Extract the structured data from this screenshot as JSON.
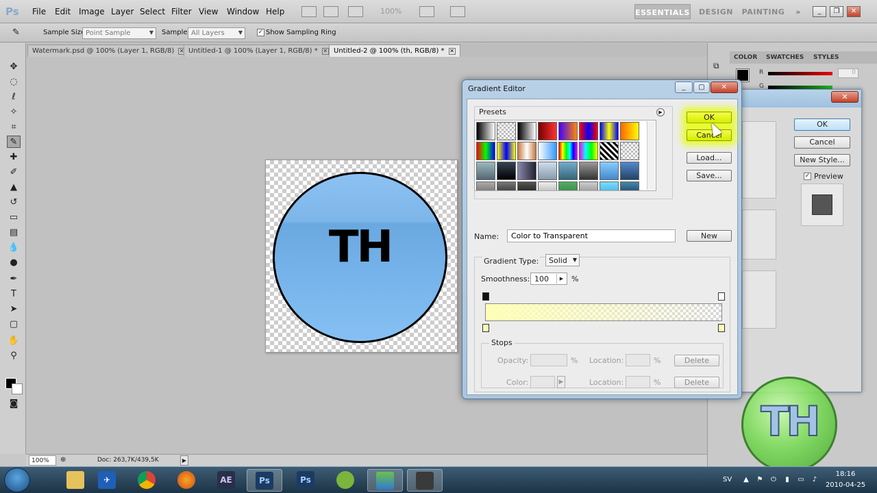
{
  "app": {
    "logo": "Ps",
    "zoom": "100%"
  },
  "menu": [
    "File",
    "Edit",
    "Image",
    "Layer",
    "Select",
    "Filter",
    "View",
    "Window",
    "Help"
  ],
  "workspaces": {
    "essentials": "ESSENTIALS",
    "design": "DESIGN",
    "painting": "PAINTING",
    "more": "»"
  },
  "options": {
    "sample_size_label": "Sample Size:",
    "sample_size_value": "Point Sample",
    "sample_label": "Sample:",
    "sample_value": "All Layers",
    "show_ring_label": "Show Sampling Ring",
    "show_ring_checked": true
  },
  "tabs": [
    {
      "label": "Watermark.psd @ 100% (Layer 1, RGB/8)",
      "active": false
    },
    {
      "label": "Untitled-1 @ 100% (Layer 1, RGB/8) *",
      "active": false
    },
    {
      "label": "Untitled-2 @ 100% (th, RGB/8) *",
      "active": true
    }
  ],
  "canvas": {
    "logo_text": "TH"
  },
  "status": {
    "zoom": "100%",
    "doc": "Doc: 263,7K/439,5K"
  },
  "panels": {
    "tabs": [
      "COLOR",
      "SWATCHES",
      "STYLES"
    ],
    "r_label": "R",
    "g_label": "G",
    "r_value": "0"
  },
  "layer_style": {
    "ok": "OK",
    "cancel": "Cancel",
    "new_style": "New Style...",
    "preview": "Preview",
    "preview_checked": true
  },
  "gradient_editor": {
    "title": "Gradient Editor",
    "presets_label": "Presets",
    "buttons": {
      "ok": "OK",
      "cancel": "Cancel",
      "load": "Load...",
      "save": "Save...",
      "new": "New"
    },
    "name_label": "Name:",
    "name_value": "Color to Transparent",
    "gradient_type_label": "Gradient Type:",
    "gradient_type_value": "Solid",
    "smoothness_label": "Smoothness:",
    "smoothness_value": "100",
    "smoothness_unit": "%",
    "stops": {
      "label": "Stops",
      "opacity_label": "Opacity:",
      "opacity_unit": "%",
      "location_label": "Location:",
      "location_unit": "%",
      "color_label": "Color:",
      "delete": "Delete"
    },
    "stop_color": "#ffffb8"
  },
  "watermark": {
    "text": "TH"
  },
  "taskbar": {
    "apps": [
      {
        "name": "explorer",
        "label": ""
      },
      {
        "name": "app-blue",
        "label": ""
      },
      {
        "name": "chrome",
        "label": ""
      },
      {
        "name": "firefox",
        "label": ""
      },
      {
        "name": "after-effects",
        "label": "AE"
      },
      {
        "name": "photoshop-1",
        "label": "Ps",
        "active": true
      },
      {
        "name": "photoshop-2",
        "label": "Ps"
      },
      {
        "name": "spotify",
        "label": ""
      },
      {
        "name": "messenger",
        "label": ""
      },
      {
        "name": "app-dark",
        "label": ""
      }
    ],
    "lang": "SV",
    "time": "18:16",
    "date": "2010-04-25"
  }
}
